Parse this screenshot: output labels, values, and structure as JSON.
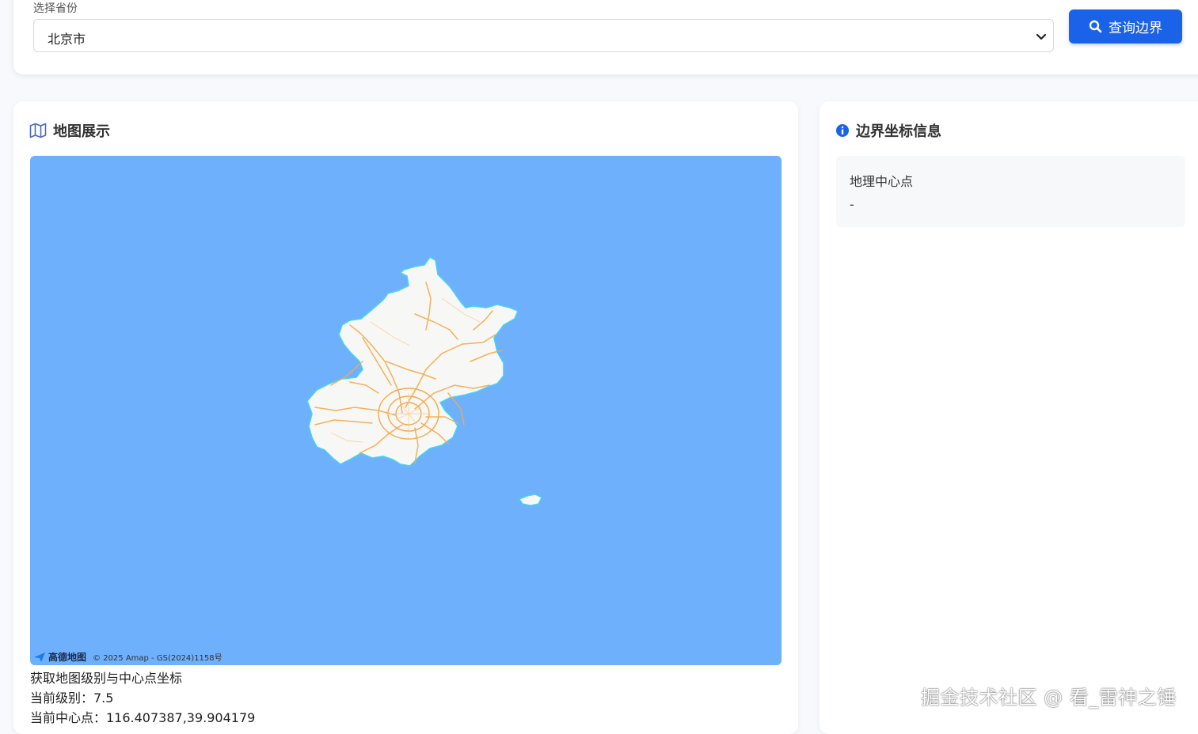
{
  "province_select": {
    "label": "选择省份",
    "value": "北京市"
  },
  "query_button": {
    "label": "查询边界",
    "icon": "search-icon"
  },
  "map_panel": {
    "title": "地图展示",
    "icon": "map-icon",
    "attribution_logo": "高德地图",
    "attribution_text": "© 2025 Amap - GS(2024)1158号",
    "ocean_color": "#6fb0fc",
    "land_color": "#f7f7f5",
    "road_color": "#f5a94a",
    "info": {
      "heading": "获取地图级别与中心点坐标",
      "zoom_line": "当前级别：7.5",
      "center_line": "当前中心点：116.407387,39.904179"
    }
  },
  "boundary_panel": {
    "title": "边界坐标信息",
    "icon": "info-icon",
    "center_label": "地理中心点",
    "center_value": "-"
  },
  "watermark": "掘金技术社区 @ 看_雷神之锤",
  "colors": {
    "accent": "#1a62e8"
  }
}
